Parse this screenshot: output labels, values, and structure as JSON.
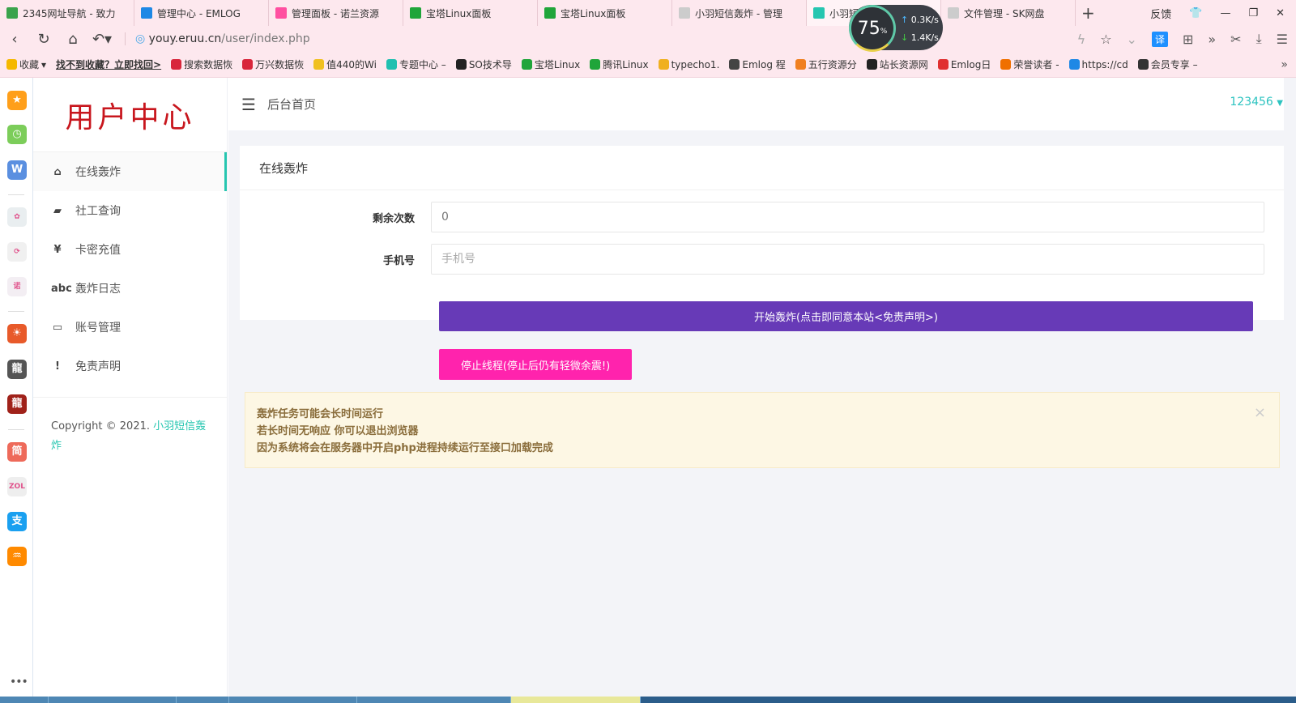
{
  "browser": {
    "tabs": [
      {
        "title": "2345网址导航 - 致力",
        "favicon_color": "#3aa34c"
      },
      {
        "title": "管理中心 - EMLOG",
        "favicon_color": "#1e88e5"
      },
      {
        "title": "管理面板 - 诺兰资源",
        "favicon_color": "#ff4fa0"
      },
      {
        "title": "宝塔Linux面板",
        "favicon_color": "#20a53a"
      },
      {
        "title": "宝塔Linux面板",
        "favicon_color": "#20a53a"
      },
      {
        "title": "小羽短信轰炸 - 管理",
        "favicon_color": "#cccccc"
      },
      {
        "title": "小羽短信轰炸 - 在线",
        "favicon_color": "#26c6b0",
        "active": true
      },
      {
        "title": "文件管理 - SK网盘",
        "favicon_color": "#cccccc"
      }
    ],
    "new_tab": "+",
    "feedback": "反馈",
    "speed": {
      "percent": "75",
      "unit": "%",
      "up": "0.3K/s",
      "down": "1.4K/s"
    },
    "url_host": "youy.eruu.cn",
    "url_path": "/user/index.php",
    "translate": "译",
    "bookmarks": [
      "收藏",
      "找不到收藏？立即找回>",
      "搜索数据恢",
      "万兴数据恢",
      "值440的Wi",
      "专题中心 –",
      "SO技术导",
      "宝塔Linux",
      "腾讯Linux",
      "typecho1.",
      "Emlog 程",
      "五行资源分",
      "站长资源网",
      "Emlog日",
      "荣誉读者 -",
      "https://cd",
      "会员专享 –"
    ]
  },
  "sidebar_apps": [
    {
      "label": "★",
      "color": "#ff9f1a"
    },
    {
      "label": "◷",
      "color": "#7ccd5a"
    },
    {
      "label": "W",
      "color": "#5a8fe0"
    },
    {
      "label": "✿",
      "color": "#e9eef0"
    },
    {
      "label": "⟳",
      "color": "#f0f0f0"
    },
    {
      "label": "诺",
      "color": "#f3eef3"
    },
    {
      "label": "☀",
      "color": "#e85a2a"
    },
    {
      "label": "龍",
      "color": "#555555"
    },
    {
      "label": "龍",
      "color": "#a0221a"
    },
    {
      "label": "简",
      "color": "#ee6a5a"
    },
    {
      "label": "ZOL",
      "color": "#eeeeee"
    },
    {
      "label": "支",
      "color": "#1aa0f0"
    },
    {
      "label": "♒",
      "color": "#ff8a00"
    }
  ],
  "app": {
    "logo": "用户中心",
    "menu": [
      {
        "icon": "home-icon",
        "glyph": "⌂",
        "label": "在线轰炸",
        "active": true
      },
      {
        "icon": "elephant-icon",
        "glyph": "▰",
        "label": "社工查询"
      },
      {
        "icon": "yen-icon",
        "glyph": "¥",
        "label": "卡密充值"
      },
      {
        "icon": "abc-icon",
        "glyph": "abc",
        "label": "轰炸日志"
      },
      {
        "icon": "monitor-icon",
        "glyph": "▭",
        "label": "账号管理"
      },
      {
        "icon": "exclamation-icon",
        "glyph": "!",
        "label": "免责声明"
      }
    ],
    "copyright": "Copyright © 2021. ",
    "copyright_link": "小羽短信轰炸"
  },
  "header": {
    "breadcrumb": "后台首页",
    "user": "123456"
  },
  "card": {
    "title": "在线轰炸",
    "remaining_label": "剩余次数",
    "remaining_value": "0",
    "phone_label": "手机号",
    "phone_placeholder": "手机号",
    "start_button": "开始轰炸(点击即同意本站<免责声明>)",
    "stop_button": "停止线程(停止后仍有轻微余震!)"
  },
  "alert": {
    "lines": [
      "轰炸任务可能会长时间运行",
      "若长时间无响应 你可以退出浏览器",
      "因为系统将会在服务器中开启php进程持续运行至接口加载完成"
    ],
    "close": "×"
  },
  "colors": {
    "accent": "#26c6b0",
    "start": "#673ab7",
    "stop": "#ff23ad",
    "logo": "#c8161d",
    "alert_bg": "#fdf7e4",
    "alert_text": "#8a6d3b"
  }
}
